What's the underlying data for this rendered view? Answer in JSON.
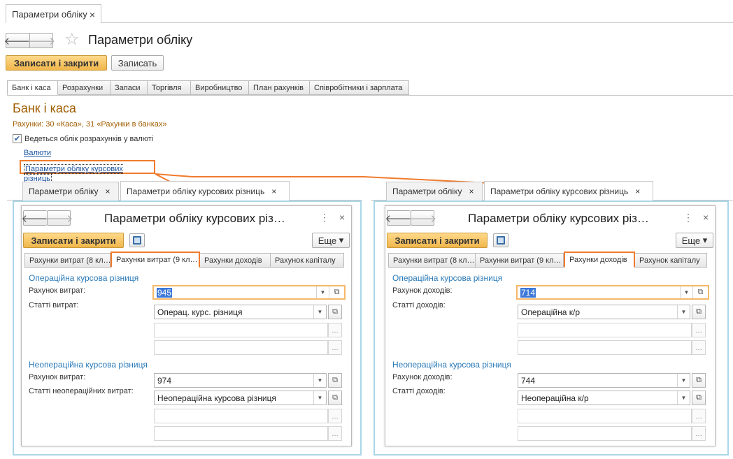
{
  "top_tab": {
    "label": "Параметри обліку",
    "close": "×"
  },
  "header": {
    "title": "Параметри обліку"
  },
  "toolbar": {
    "save_close": "Записати і закрити",
    "save": "Записать"
  },
  "main_tabs": [
    "Банк і каса",
    "Розрахунки",
    "Запаси",
    "Торгівля",
    "Виробництво",
    "План рахунків",
    "Співробітники і зарплата"
  ],
  "section": {
    "title": "Банк і каса",
    "accounts_note": "Рахунки: 30 «Каса», 31 «Рахунки в банках»",
    "checkbox_label": "Ведеться облік розрахунків у валюті",
    "link_currencies": "Валюти",
    "link_params": "Параметри обліку курсових різниць"
  },
  "left": {
    "tabs": [
      "Параметри обліку",
      "Параметри обліку курсових різниць"
    ],
    "window_title": "Параметри обліку курсових різ…",
    "save_close": "Записати і закрити",
    "more": "Еще",
    "inner_tabs": [
      "Рахунки витрат (8 кл…",
      "Рахунки витрат (9 кл…",
      "Рахунки доходів",
      "Рахунок капіталу"
    ],
    "op_title": "Операційна курсова різниця",
    "op_account_label": "Рахунок витрат:",
    "op_account_value": "945",
    "op_items_label": "Статті витрат:",
    "op_items_value": "Операц. курс. різниця",
    "nonop_title": "Неопераційна курсова різниця",
    "nonop_account_label": "Рахунок витрат:",
    "nonop_account_value": "974",
    "nonop_items_label": "Статті неопераційних витрат:",
    "nonop_items_value": "Неопераційна курсова різниця"
  },
  "right": {
    "tabs": [
      "Параметри обліку",
      "Параметри обліку курсових різниць"
    ],
    "window_title": "Параметри обліку курсових різ…",
    "save_close": "Записати і закрити",
    "more": "Еще",
    "inner_tabs": [
      "Рахунки витрат (8 кл…",
      "Рахунки витрат (9 кл…",
      "Рахунки доходів",
      "Рахунок капіталу"
    ],
    "op_title": "Операційна курсова різниця",
    "op_account_label": "Рахунок доходів:",
    "op_account_value": "714",
    "op_items_label": "Статті доходів:",
    "op_items_value": "Операційна к/р",
    "nonop_title": "Неопераційна курсова різниця",
    "nonop_account_label": "Рахунок доходів:",
    "nonop_account_value": "744",
    "nonop_items_label": "Статті доходів:",
    "nonop_items_value": "Неопераційна к/р"
  },
  "colors": {
    "accent": "#f07b2c",
    "frame": "#a9d7e8",
    "section_title": "#a05d00",
    "blue_heading": "#2a7ab8"
  }
}
